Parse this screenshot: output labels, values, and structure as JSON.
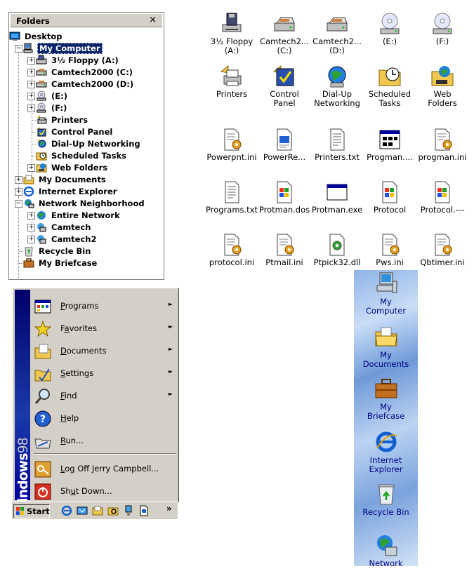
{
  "folders": {
    "title": "Folders",
    "close": "×",
    "nodes": [
      {
        "label": "Desktop"
      },
      {
        "label": "My Computer"
      },
      {
        "label": "3½ Floppy (A:)"
      },
      {
        "label": "Camtech2000 (C:)"
      },
      {
        "label": "Camtech2000 (D:)"
      },
      {
        "label": "(E:)"
      },
      {
        "label": "(F:)"
      },
      {
        "label": "Printers"
      },
      {
        "label": "Control Panel"
      },
      {
        "label": "Dial-Up Networking"
      },
      {
        "label": "Scheduled Tasks"
      },
      {
        "label": "Web Folders"
      },
      {
        "label": "My Documents"
      },
      {
        "label": "Internet Explorer"
      },
      {
        "label": "Network Neighborhood"
      },
      {
        "label": "Entire Network"
      },
      {
        "label": "Camtech"
      },
      {
        "label": "Camtech2"
      },
      {
        "label": "Recycle Bin"
      },
      {
        "label": "My Briefcase"
      }
    ]
  },
  "grid": {
    "items": [
      {
        "l1": "3½ Floppy",
        "l2": "(A:)",
        "icon": "floppy-drive-icon"
      },
      {
        "l1": "Camtech2...",
        "l2": "(C:)",
        "icon": "hard-drive-icon"
      },
      {
        "l1": "Camtech2...",
        "l2": "(D:)",
        "icon": "hard-drive-icon"
      },
      {
        "l1": "(E:)",
        "l2": "",
        "icon": "cd-drive-icon"
      },
      {
        "l1": "(F:)",
        "l2": "",
        "icon": "cd-drive-icon"
      },
      {
        "l1": "Printers",
        "l2": "",
        "icon": "printers-icon"
      },
      {
        "l1": "Control",
        "l2": "Panel",
        "icon": "control-panel-icon"
      },
      {
        "l1": "Dial-Up",
        "l2": "Networking",
        "icon": "dialup-icon"
      },
      {
        "l1": "Scheduled",
        "l2": "Tasks",
        "icon": "scheduled-tasks-icon"
      },
      {
        "l1": "Web",
        "l2": "Folders",
        "icon": "web-folders-icon"
      },
      {
        "l1": "Powerpnt.ini",
        "l2": "",
        "icon": "ini-file-icon"
      },
      {
        "l1": "PowerRe...",
        "l2": "",
        "icon": "document-icon"
      },
      {
        "l1": "Printers.txt",
        "l2": "",
        "icon": "text-file-icon"
      },
      {
        "l1": "Progman....",
        "l2": "",
        "icon": "program-manager-icon"
      },
      {
        "l1": "progman.ini",
        "l2": "",
        "icon": "ini-file-icon"
      },
      {
        "l1": "Programs.txt",
        "l2": "",
        "icon": "text-file-icon"
      },
      {
        "l1": "Protman.dos",
        "l2": "",
        "icon": "windows-file-icon"
      },
      {
        "l1": "Protman.exe",
        "l2": "",
        "icon": "exe-window-icon"
      },
      {
        "l1": "Protocol",
        "l2": "",
        "icon": "windows-file-icon"
      },
      {
        "l1": "Protocol.---",
        "l2": "",
        "icon": "windows-file-icon"
      },
      {
        "l1": "protocol.ini",
        "l2": "",
        "icon": "ini-file-icon"
      },
      {
        "l1": "Ptmail.ini",
        "l2": "",
        "icon": "ini-file-icon"
      },
      {
        "l1": "Ptpick32.dll",
        "l2": "",
        "icon": "dll-file-icon"
      },
      {
        "l1": "Pws.ini",
        "l2": "",
        "icon": "ini-file-icon"
      },
      {
        "l1": "Qbtimer.ini",
        "l2": "",
        "icon": "ini-file-icon"
      }
    ]
  },
  "startmenu": {
    "brand_bold": "Windows",
    "brand_num": "98",
    "items": [
      {
        "pre": "",
        "key": "P",
        "post": "rograms",
        "arrow": "►"
      },
      {
        "pre": "F",
        "key": "a",
        "post": "vorites",
        "arrow": "►"
      },
      {
        "pre": "",
        "key": "D",
        "post": "ocuments",
        "arrow": "►"
      },
      {
        "pre": "",
        "key": "S",
        "post": "ettings",
        "arrow": "►"
      },
      {
        "pre": "",
        "key": "F",
        "post": "ind",
        "arrow": "►"
      },
      {
        "pre": "",
        "key": "H",
        "post": "elp",
        "arrow": ""
      },
      {
        "pre": "",
        "key": "R",
        "post": "un...",
        "arrow": ""
      },
      {
        "pre": "",
        "key": "L",
        "post": "og Off Jerry Campbell...",
        "arrow": ""
      },
      {
        "pre": "Sh",
        "key": "u",
        "post": "t Down...",
        "arrow": ""
      }
    ]
  },
  "taskbar": {
    "start_label": "Start",
    "more": "»"
  },
  "desktop": {
    "items": [
      {
        "l1": "My",
        "l2": "Computer"
      },
      {
        "l1": "My",
        "l2": "Documents"
      },
      {
        "l1": "My",
        "l2": "Briefcase"
      },
      {
        "l1": "Internet",
        "l2": "Explorer"
      },
      {
        "l1": "Recycle Bin",
        "l2": ""
      },
      {
        "l1": "Network",
        "l2": ""
      }
    ]
  }
}
